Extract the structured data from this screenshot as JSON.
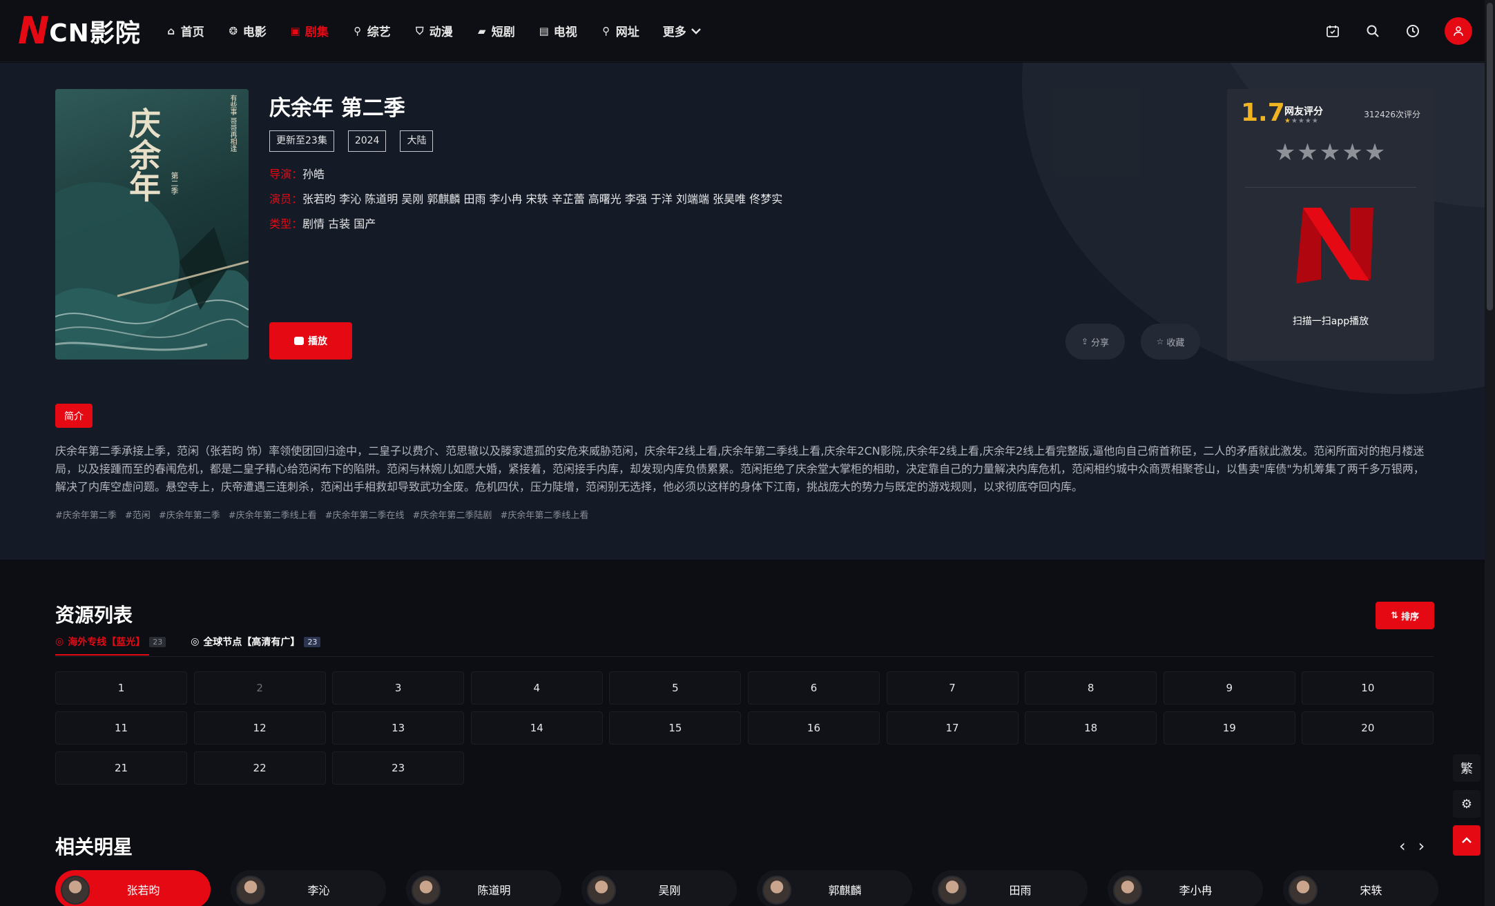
{
  "header": {
    "logo_n": "N",
    "logo_text": "CN影院",
    "nav": [
      {
        "label": "首页",
        "icon": "home-icon"
      },
      {
        "label": "电影",
        "icon": "film-reel-icon"
      },
      {
        "label": "剧集",
        "icon": "tv-series-icon",
        "active": true
      },
      {
        "label": "综艺",
        "icon": "link-icon"
      },
      {
        "label": "动漫",
        "icon": "shield-icon"
      },
      {
        "label": "短剧",
        "icon": "tablet-icon"
      },
      {
        "label": "电视",
        "icon": "tv-icon"
      },
      {
        "label": "网址",
        "icon": "link-icon"
      },
      {
        "label": "更多",
        "icon": "chevron-down-icon"
      }
    ]
  },
  "detail": {
    "title": "庆余年 第二季",
    "tags": [
      "更新至23集",
      "2024",
      "大陆"
    ],
    "director_label": "导演：",
    "director": "孙皓",
    "cast_label": "演员：",
    "cast": "张若昀 李沁 陈道明 吴刚 郭麒麟 田雨 李小冉 宋轶 辛芷蕾 高曙光 李强 于洋 刘端端 张昊唯 佟梦实",
    "genre_label": "类型：",
    "genre": "剧情 古装 国产",
    "play_label": "播放",
    "share_label": "分享",
    "favorite_label": "收藏",
    "poster_text": "庆余年",
    "poster_subtitle": "第二季",
    "poster_side_text": "有些事 哥哥再相逢"
  },
  "rating": {
    "score": "1.7",
    "label": "网友评分",
    "votes": "312426次评分",
    "scan_text": "扫描一扫app播放",
    "stars_filled_fraction": 0.17,
    "accent": "#f0b322"
  },
  "intro": {
    "badge": "简介",
    "text": "庆余年第二季承接上季，范闲（张若昀 饰）率领使团回归途中，二皇子以费介、范思辙以及滕家遗孤的安危来威胁范闲，庆余年2线上看,庆余年第二季线上看,庆余年2CN影院,庆余年2线上看,庆余年2线上看完整版,逼他向自己俯首称臣，二人的矛盾就此激发。范闲所面对的抱月楼迷局，以及接踵而至的春闱危机，都是二皇子精心给范闲布下的陷阱。范闲与林婉儿如愿大婚，紧接着，范闲接手内库，却发现内库负债累累。范闲拒绝了庆余堂大掌柜的相助，决定靠自己的力量解决内库危机，范闲相约城中众商贾相聚苍山，以售卖\"库债\"为机筹集了两千多万银两，解决了内库空虚问题。悬空寺上，庆帝遭遇三连刺杀，范闲出手相救却导致武功全废。危机四伏，压力陡增，范闲别无选择，他必须以这样的身体下江南，挑战庞大的势力与既定的游戏规则，以求彻底夺回内库。",
    "hashtags": [
      "#庆余年第二季",
      "#范闲",
      "#庆余年第二季",
      "#庆余年第二季线上看",
      "#庆余年第二季在线",
      "#庆余年第二季陆剧",
      "#庆余年第二季线上看"
    ]
  },
  "resources": {
    "title": "资源列表",
    "sort_label": "排序",
    "sources": [
      {
        "name": "海外专线【蓝光】",
        "count": "23",
        "active": true
      },
      {
        "name": "全球节点【高清有广】",
        "count": "23",
        "active": false
      }
    ],
    "episodes": [
      "1",
      "2",
      "3",
      "4",
      "5",
      "6",
      "7",
      "8",
      "9",
      "10",
      "11",
      "12",
      "13",
      "14",
      "15",
      "16",
      "17",
      "18",
      "19",
      "20",
      "21",
      "22",
      "23"
    ],
    "watched_episode": "2"
  },
  "stars": {
    "title": "相关明星",
    "items": [
      "张若昀",
      "李沁",
      "陈道明",
      "吴刚",
      "郭麒麟",
      "田雨",
      "李小冉",
      "宋轶"
    ]
  },
  "floating": {
    "traditional_label": "繁"
  },
  "colors": {
    "brand": "#e50914",
    "background": "#0d0e13",
    "hero": "#141b26"
  }
}
